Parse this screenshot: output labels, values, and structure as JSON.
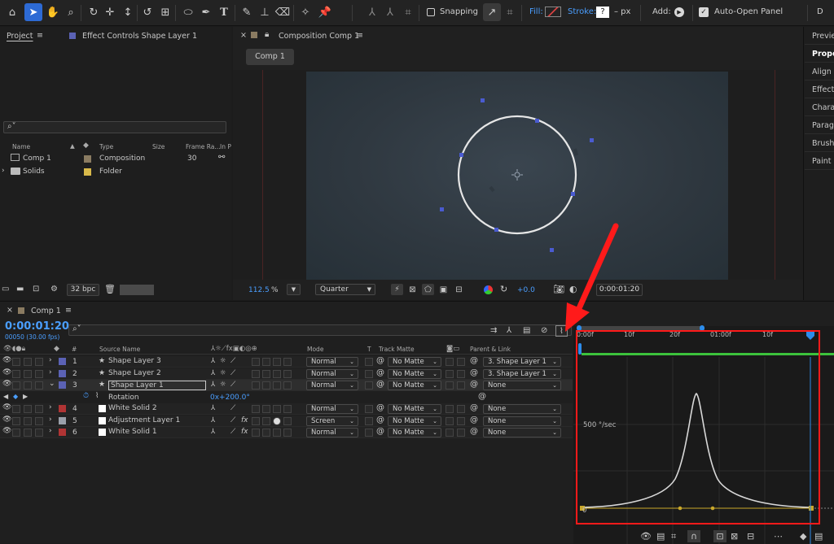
{
  "toolbar": {
    "snapping_label": "Snapping",
    "fill_label": "Fill:",
    "stroke_label": "Stroke:",
    "stroke_value": "?",
    "stroke_unit": "– px",
    "add_label": "Add:",
    "auto_open_label": "Auto-Open Panel",
    "auto_open_checked": true,
    "fill_color": "#d44040",
    "right_cut": "D"
  },
  "project_panel": {
    "tab_project": "Project",
    "tab_effect_controls": "Effect Controls Shape Layer 1",
    "search_placeholder": "",
    "columns": {
      "name": "Name",
      "type": "Type",
      "size": "Size",
      "frame_rate": "Frame Ra...",
      "in_point": "In P"
    },
    "items": [
      {
        "name": "Comp 1",
        "type": "Composition",
        "size": "",
        "frame_rate": "30",
        "color": "#8a7b61"
      },
      {
        "name": "Solids",
        "type": "Folder",
        "size": "",
        "frame_rate": "",
        "color": "#d8b94a"
      }
    ],
    "bpc": "32 bpc"
  },
  "composition_panel": {
    "tab_label": "Composition Comp 1",
    "comp_tab": "Comp 1",
    "zoom": "112.5",
    "zoom_unit": "%",
    "resolution": "Quarter",
    "exposure": "+0.0",
    "timecode": "0:00:01:20"
  },
  "right_panels": [
    "Previe",
    "Proper",
    "Align",
    "Effects",
    "Charac",
    "Paragr",
    "Brushe",
    "Paint"
  ],
  "timeline": {
    "tab_label": "Comp 1",
    "current_time": "0:00:01:20",
    "frame_info": "00050 (30.00 fps)",
    "search_placeholder": "",
    "columns": {
      "num": "#",
      "source_name": "Source Name",
      "mode": "Mode",
      "t": "T",
      "track_matte": "Track Matte",
      "parent": "Parent & Link"
    },
    "layers": [
      {
        "num": "1",
        "name": "Shape Layer 3",
        "color": "#5b62b5",
        "star": true,
        "fx": false,
        "mode": "Normal",
        "matte": "No Matte",
        "parent": "3. Shape Layer 1",
        "selected": false
      },
      {
        "num": "2",
        "name": "Shape Layer 2",
        "color": "#5b62b5",
        "star": true,
        "fx": false,
        "mode": "Normal",
        "matte": "No Matte",
        "parent": "3. Shape Layer 1",
        "selected": false
      },
      {
        "num": "3",
        "name": "Shape Layer 1",
        "color": "#5b62b5",
        "star": true,
        "fx": false,
        "mode": "Normal",
        "matte": "No Matte",
        "parent": "None",
        "selected": true
      },
      {
        "num": "4",
        "name": "White Solid 2",
        "color": "#b03434",
        "star": false,
        "fx": false,
        "mode": "Normal",
        "matte": "No Matte",
        "parent": "None",
        "selected": false
      },
      {
        "num": "5",
        "name": "Adjustment Layer 1",
        "color": "#9aa0aa",
        "star": false,
        "fx": true,
        "mode": "Screen",
        "matte": "No Matte",
        "parent": "None",
        "selected": false
      },
      {
        "num": "6",
        "name": "White Solid 1",
        "color": "#b03434",
        "star": false,
        "fx": true,
        "mode": "Normal",
        "matte": "No Matte",
        "parent": "None",
        "selected": false
      }
    ],
    "property": {
      "name": "Rotation",
      "value": "0x+200.0°"
    },
    "ruler_labels": [
      "0:00f",
      "10f",
      "20f",
      "01:00f",
      "10f"
    ],
    "graph_label": "500 °/sec",
    "graph_zero": "0"
  },
  "colors": {
    "accent_blue": "#2d8ceb",
    "highlight_red": "#ff1a1a",
    "timecode_blue": "#4a9eff"
  }
}
